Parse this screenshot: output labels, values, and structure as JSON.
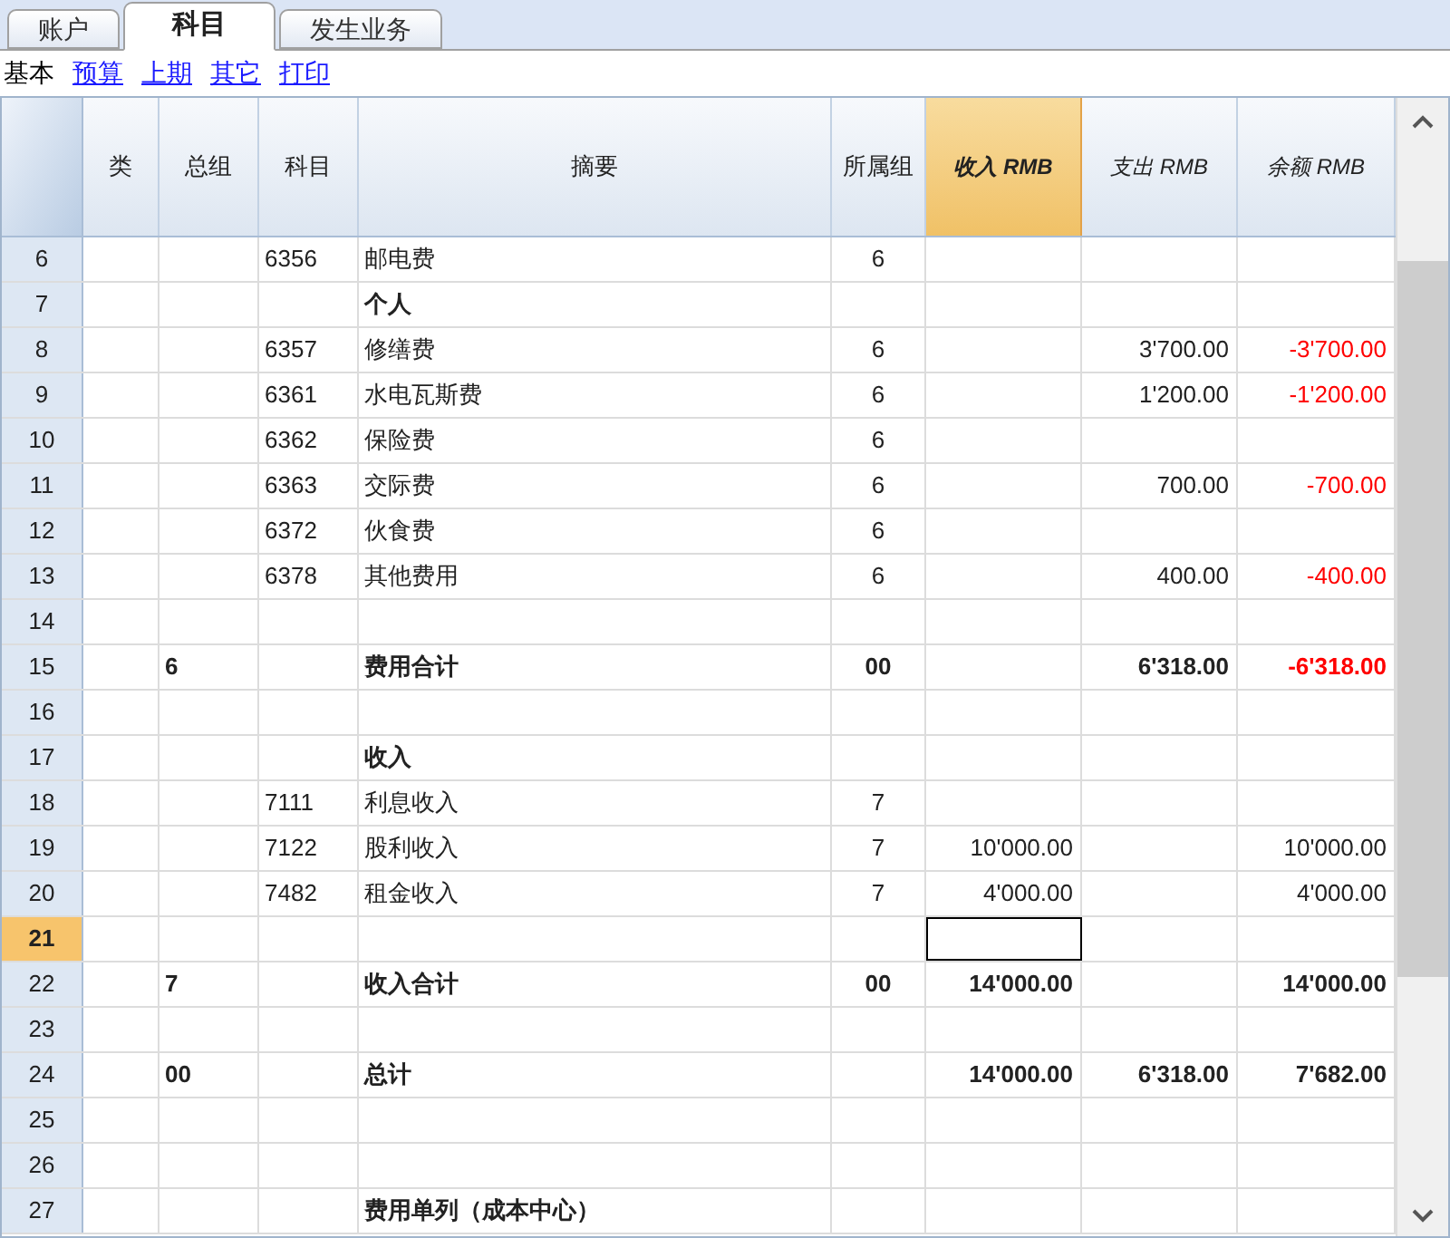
{
  "tabs": [
    {
      "label": "账户",
      "selected": false
    },
    {
      "label": "科目",
      "selected": true
    },
    {
      "label": "发生业务",
      "selected": false
    }
  ],
  "views": [
    {
      "label": "基本",
      "selected": true
    },
    {
      "label": "预算",
      "selected": false
    },
    {
      "label": "上期",
      "selected": false
    },
    {
      "label": "其它",
      "selected": false
    },
    {
      "label": "打印",
      "selected": false
    }
  ],
  "table": {
    "columns": [
      {
        "label": "类",
        "selected": false
      },
      {
        "label": "总组",
        "selected": false
      },
      {
        "label": "科目",
        "selected": false
      },
      {
        "label": "摘要",
        "selected": false
      },
      {
        "label": "所属组",
        "selected": false
      },
      {
        "label": "收入 RMB",
        "selected": true
      },
      {
        "label": "支出 RMB",
        "selected": false
      },
      {
        "label": "余额 RMB",
        "selected": false
      }
    ],
    "rows": [
      {
        "number": "6",
        "account": "6356",
        "description": "邮电费",
        "group_of": "6",
        "bold": false,
        "selected": false
      },
      {
        "number": "7",
        "description": "个人",
        "bold": true,
        "selected": false
      },
      {
        "number": "8",
        "account": "6357",
        "description": "修缮费",
        "group_of": "6",
        "expense": "3'700.00",
        "balance": "-3'700.00",
        "bold": false,
        "negative": true,
        "selected": false
      },
      {
        "number": "9",
        "account": "6361",
        "description": "水电瓦斯费",
        "group_of": "6",
        "expense": "1'200.00",
        "balance": "-1'200.00",
        "bold": false,
        "negative": true,
        "selected": false
      },
      {
        "number": "10",
        "account": "6362",
        "description": "保险费",
        "group_of": "6",
        "bold": false,
        "selected": false
      },
      {
        "number": "11",
        "account": "6363",
        "description": "交际费",
        "group_of": "6",
        "expense": "700.00",
        "balance": "-700.00",
        "bold": false,
        "negative": true,
        "selected": false
      },
      {
        "number": "12",
        "account": "6372",
        "description": "伙食费",
        "group_of": "6",
        "bold": false,
        "selected": false
      },
      {
        "number": "13",
        "account": "6378",
        "description": "其他费用",
        "group_of": "6",
        "expense": "400.00",
        "balance": "-400.00",
        "bold": false,
        "negative": true,
        "selected": false
      },
      {
        "number": "14",
        "selected": false
      },
      {
        "number": "15",
        "group": "6",
        "description": "费用合计",
        "group_of": "00",
        "expense": "6'318.00",
        "balance": "-6'318.00",
        "bold": true,
        "negative": true,
        "selected": false
      },
      {
        "number": "16",
        "selected": false
      },
      {
        "number": "17",
        "description": "收入",
        "bold": true,
        "selected": false
      },
      {
        "number": "18",
        "account": "7111",
        "description": "利息收入",
        "group_of": "7",
        "bold": false,
        "selected": false
      },
      {
        "number": "19",
        "account": "7122",
        "description": "股利收入",
        "group_of": "7",
        "income": "10'000.00",
        "balance": "10'000.00",
        "bold": false,
        "negative": false,
        "selected": false
      },
      {
        "number": "20",
        "account": "7482",
        "description": "租金收入",
        "group_of": "7",
        "income": "4'000.00",
        "balance": "4'000.00",
        "bold": false,
        "negative": false,
        "selected": false
      },
      {
        "number": "21",
        "selected": true
      },
      {
        "number": "22",
        "group": "7",
        "description": "收入合计",
        "group_of": "00",
        "income": "14'000.00",
        "balance": "14'000.00",
        "bold": true,
        "negative": false,
        "selected": false
      },
      {
        "number": "23",
        "selected": false
      },
      {
        "number": "24",
        "group": "00",
        "description": "总计",
        "income": "14'000.00",
        "expense": "6'318.00",
        "balance": "7'682.00",
        "bold": true,
        "negative": false,
        "selected": false
      },
      {
        "number": "25",
        "selected": false
      },
      {
        "number": "26",
        "selected": false
      },
      {
        "number": "27",
        "description": "费用单列（成本中心）",
        "bold": true,
        "selected": false
      }
    ]
  }
}
